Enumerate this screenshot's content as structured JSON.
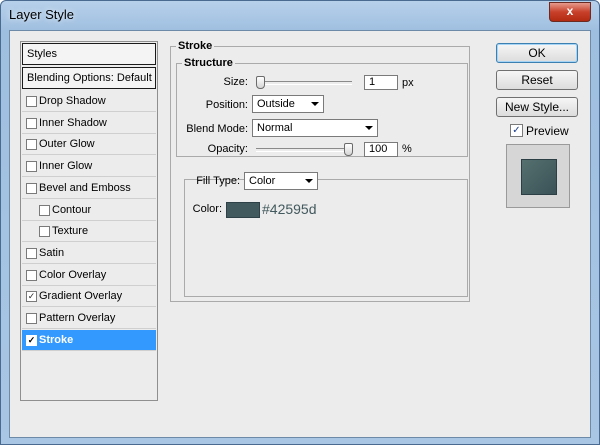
{
  "window": {
    "title": "Layer Style",
    "close_label": "x"
  },
  "styles_panel": {
    "header": "Styles",
    "blending": "Blending Options: Default",
    "items": [
      {
        "label": "Drop Shadow",
        "checked": false,
        "indent": false,
        "selected": false
      },
      {
        "label": "Inner Shadow",
        "checked": false,
        "indent": false,
        "selected": false
      },
      {
        "label": "Outer Glow",
        "checked": false,
        "indent": false,
        "selected": false
      },
      {
        "label": "Inner Glow",
        "checked": false,
        "indent": false,
        "selected": false
      },
      {
        "label": "Bevel and Emboss",
        "checked": false,
        "indent": false,
        "selected": false
      },
      {
        "label": "Contour",
        "checked": false,
        "indent": true,
        "selected": false
      },
      {
        "label": "Texture",
        "checked": false,
        "indent": true,
        "selected": false
      },
      {
        "label": "Satin",
        "checked": false,
        "indent": false,
        "selected": false
      },
      {
        "label": "Color Overlay",
        "checked": false,
        "indent": false,
        "selected": false
      },
      {
        "label": "Gradient Overlay",
        "checked": true,
        "indent": false,
        "selected": false
      },
      {
        "label": "Pattern Overlay",
        "checked": false,
        "indent": false,
        "selected": false
      },
      {
        "label": "Stroke",
        "checked": true,
        "indent": false,
        "selected": true
      }
    ]
  },
  "stroke": {
    "title": "Stroke",
    "structure_title": "Structure",
    "size_label": "Size:",
    "size_value": "1",
    "size_unit": "px",
    "size_level": 0.0,
    "position_label": "Position:",
    "position_value": "Outside",
    "blend_label": "Blend Mode:",
    "blend_value": "Normal",
    "opacity_label": "Opacity:",
    "opacity_value": "100",
    "opacity_unit": "%",
    "opacity_level": 1.0,
    "fill_type_label": "Fill Type:",
    "fill_type_value": "Color",
    "color_label": "Color:",
    "color_hex": "#42595d",
    "color_value": "#42595d"
  },
  "buttons": {
    "ok": "OK",
    "reset": "Reset",
    "new_style": "New Style...",
    "preview": "Preview",
    "preview_checked": true
  }
}
